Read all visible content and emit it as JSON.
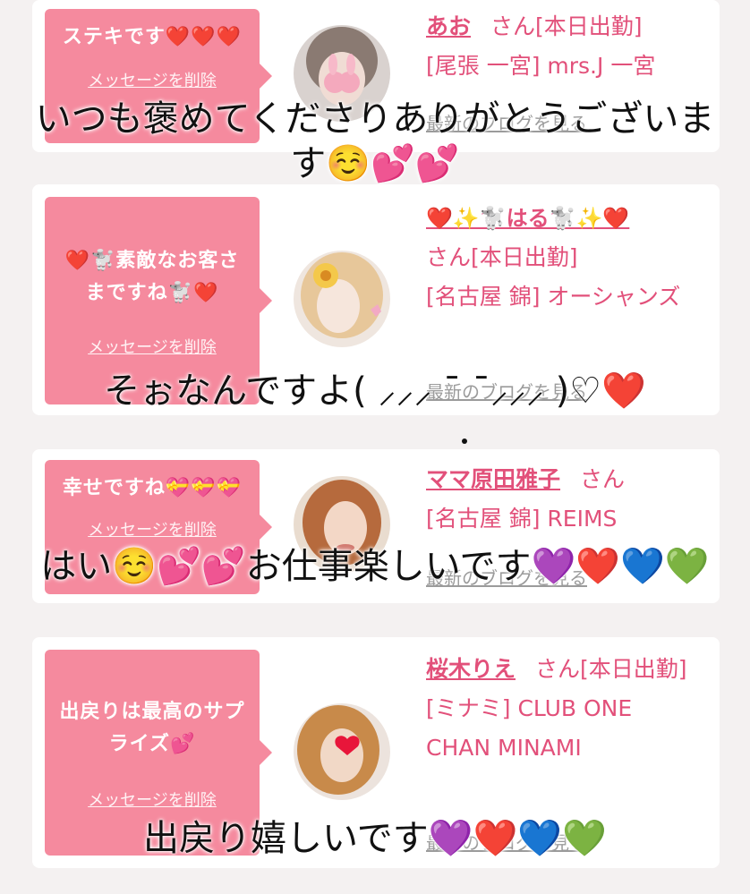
{
  "colors": {
    "accent": "#e2507a",
    "bubble": "#f58a9e",
    "background": "#f4f1f1"
  },
  "cards": [
    {
      "message": "ステキです❤️❤️❤️",
      "delete_label": "メッセージを削除",
      "name": "あお",
      "san": "さん[本日出勤]",
      "store": "[尾張 一宮] mrs.J 一宮",
      "blog_label": "最新のブログを見る"
    },
    {
      "message": "❤️🐩素敵なお客さまですね🐩❤️",
      "delete_label": "メッセージを削除",
      "name": "❤️✨🐩はる🐩✨❤️",
      "san": "さん[本日出勤]",
      "store": "[名古屋 錦] オーシャンズ",
      "blog_label": "最新のブログを見る"
    },
    {
      "message": "幸せですね💝💝💝",
      "delete_label": "メッセージを削除",
      "name": "ママ原田雅子",
      "san": "さん",
      "store": "[名古屋 錦] REIMS",
      "blog_label": "最新のブログを見る"
    },
    {
      "message": "出戻りは最高のサプライズ💕",
      "delete_label": "メッセージを削除",
      "name": "桜木りえ",
      "san": "さん[本日出勤]",
      "store": "[ミナミ] CLUB ONE CHAN MINAMI",
      "blog_label": "最新のブログを見る"
    }
  ],
  "overlays": [
    "いつも褒めてくださりありがとうございます☺️💕💕",
    "そぉなんですよ( ⸝⸝⸝ ¯ ¯⸝⸝⸝ )♡❤️",
    "はい☺️💕💕お仕事楽しいです💜❤️💙💚",
    "出戻り嬉しいです💜❤️💙💚"
  ]
}
